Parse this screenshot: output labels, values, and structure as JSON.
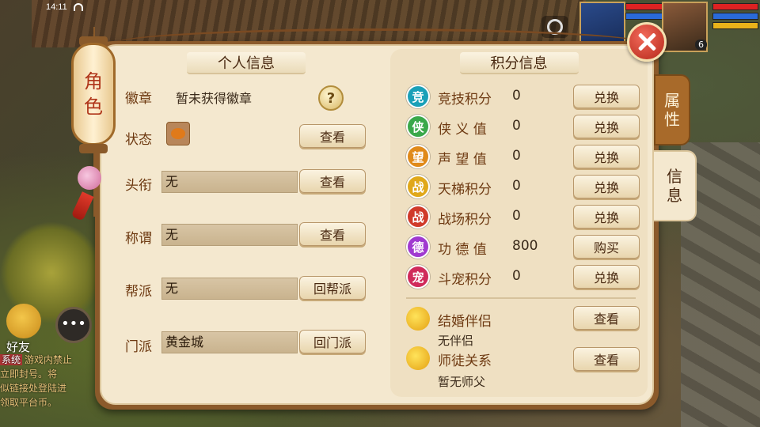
{
  "status_bar": {
    "time": "14:11"
  },
  "hud": {
    "level": "6"
  },
  "side_left": {
    "friend_label": "好友",
    "chat": [
      {
        "tag": "系统",
        "text": "游戏内禁止"
      },
      {
        "tag": "",
        "text": "立即封号。将"
      },
      {
        "tag": "",
        "text": "似链接处登陆进"
      },
      {
        "tag": "",
        "text": "领取平台币。"
      }
    ]
  },
  "lantern": {
    "char1": "角",
    "char2": "色"
  },
  "personal": {
    "title": "个人信息",
    "badge_label": "徽章",
    "badge_value": "暂未获得徽章",
    "help_symbol": "?",
    "status_label": "状态",
    "status_button": "查看",
    "title_label": "头衔",
    "title_value": "无",
    "title_button": "查看",
    "appellation_label": "称谓",
    "appellation_value": "无",
    "appellation_button": "查看",
    "guild_label": "帮派",
    "guild_value": "无",
    "guild_button": "回帮派",
    "sect_label": "门派",
    "sect_value": "黄金城",
    "sect_button": "回门派"
  },
  "points": {
    "title": "积分信息",
    "rows": [
      {
        "badge": "竞",
        "color": "#1aa0b8",
        "name": "竞技积分",
        "value": "0",
        "button": "兑换"
      },
      {
        "badge": "侠",
        "color": "#3aa84a",
        "name": "侠 义 值",
        "value": "0",
        "button": "兑换"
      },
      {
        "badge": "望",
        "color": "#e08a1a",
        "name": "声 望 值",
        "value": "0",
        "button": "兑换"
      },
      {
        "badge": "战",
        "color": "#e0a81a",
        "name": "天梯积分",
        "value": "0",
        "button": "兑换"
      },
      {
        "badge": "战",
        "color": "#d03a2a",
        "name": "战场积分",
        "value": "0",
        "button": "兑换"
      },
      {
        "badge": "德",
        "color": "#a03ad0",
        "name": "功 德 值",
        "value": "800",
        "button": "购买"
      },
      {
        "badge": "宠",
        "color": "#d02a5a",
        "name": "斗宠积分",
        "value": "0",
        "button": "兑换"
      }
    ],
    "marriage_label": "结婚伴侣",
    "marriage_value": "无伴侣",
    "marriage_button": "查看",
    "mentor_label": "师徒关系",
    "mentor_value": "暂无师父",
    "mentor_button": "查看"
  },
  "tabs": {
    "attributes": {
      "c1": "属",
      "c2": "性"
    },
    "info": {
      "c1": "信",
      "c2": "息"
    }
  }
}
